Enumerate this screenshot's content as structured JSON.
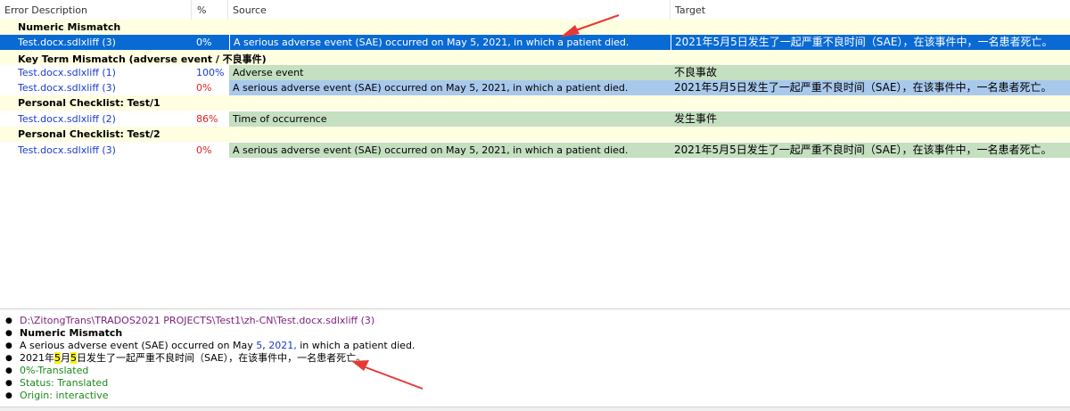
{
  "columns": {
    "error": "Error Description",
    "pct": "%",
    "source": "Source",
    "target": "Target"
  },
  "groups": [
    {
      "title": "Numeric Mismatch"
    },
    {
      "title": "Key Term Mismatch (adverse event / 不良事件)"
    },
    {
      "title": "Personal Checklist: Test/1"
    },
    {
      "title": "Personal Checklist: Test/2"
    }
  ],
  "rows": [
    {
      "file": "Test.docx.sdlxliff (3)",
      "pct": "0%",
      "source": "A serious adverse event (SAE) occurred on May 5, 2021, in which a patient died.",
      "target": "2021年5月5日发生了一起严重不良时间（SAE），在该事件中，一名患者死亡。"
    },
    {
      "file": "Test.docx.sdlxliff (1)",
      "pct": "100%",
      "source": "Adverse event",
      "target": "不良事故"
    },
    {
      "file": "Test.docx.sdlxliff (3)",
      "pct": "0%",
      "source": "A serious adverse event (SAE) occurred on May 5, 2021, in which a patient died.",
      "target": "2021年5月5日发生了一起严重不良时间（SAE），在该事件中，一名患者死亡。"
    },
    {
      "file": "Test.docx.sdlxliff (2)",
      "pct": "86%",
      "source": "Time of occurrence",
      "target": "发生事件"
    },
    {
      "file": "Test.docx.sdlxliff (3)",
      "pct": "0%",
      "source": "A serious adverse event (SAE) occurred on May 5, 2021, in which a patient died.",
      "target": "2021年5月5日发生了一起严重不良时间（SAE），在该事件中，一名患者死亡。"
    }
  ],
  "details": {
    "path": "D:\\ZitongTrans\\TRADOS2021 PROJECTS\\Test1\\zh-CN\\Test.docx.sdlxliff (3)",
    "error_type": "Numeric Mismatch",
    "source_pre": "A serious adverse event (SAE) occurred on May ",
    "source_num1": "5",
    "source_mid": ", ",
    "source_num2": "2021,",
    "source_post": " in which a patient died.",
    "target_pre": "2021年",
    "target_num1": "5",
    "target_mid": "月",
    "target_num2": "5",
    "target_post": "日发生了一起严重不良时间（SAE），在该事件中，一名患者死亡。",
    "percent": "0%-Translated",
    "status": "Status: Translated",
    "origin": "Origin: interactive"
  },
  "colors": {
    "selected": "#0a6ad4",
    "match": "#c5dfc1",
    "highlight": "#a9c9ec",
    "group_bg": "#ffffe1",
    "arrow": "#e53935"
  }
}
